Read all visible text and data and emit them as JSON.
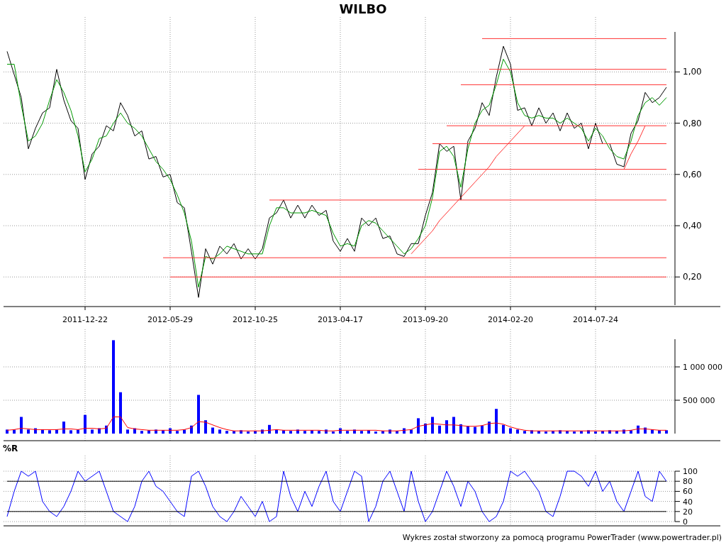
{
  "price_chart": {
    "chart_data": {
      "type": "line",
      "title": "WILBO",
      "categories": [
        null,
        null,
        null,
        null,
        null,
        null,
        null,
        null,
        null,
        null,
        null,
        "2011-12-22",
        null,
        null,
        null,
        null,
        null,
        null,
        null,
        null,
        null,
        null,
        null,
        "2012-05-29",
        null,
        null,
        null,
        null,
        null,
        null,
        null,
        null,
        null,
        null,
        null,
        "2012-10-25",
        null,
        null,
        null,
        null,
        null,
        null,
        null,
        null,
        null,
        null,
        null,
        "2013-04-17",
        null,
        null,
        null,
        null,
        null,
        null,
        null,
        null,
        null,
        null,
        null,
        "2013-09-20",
        null,
        null,
        null,
        null,
        null,
        null,
        null,
        null,
        null,
        null,
        null,
        "2014-02-20",
        null,
        null,
        null,
        null,
        null,
        null,
        null,
        null,
        null,
        null,
        null,
        "2014-07-24",
        null,
        null,
        null,
        null,
        null,
        null,
        null,
        null,
        null,
        null
      ],
      "series": [
        {
          "color": "#000000",
          "values": [
            1.08,
            0.99,
            0.9,
            0.7,
            0.78,
            0.84,
            0.86,
            1.01,
            0.89,
            0.81,
            0.78,
            0.58,
            0.68,
            0.71,
            0.79,
            0.77,
            0.88,
            0.83,
            0.75,
            0.77,
            0.66,
            0.67,
            0.59,
            0.6,
            0.49,
            0.47,
            0.3,
            0.12,
            0.31,
            0.25,
            0.32,
            0.29,
            0.33,
            0.27,
            0.31,
            0.27,
            0.31,
            0.43,
            0.45,
            0.5,
            0.43,
            0.48,
            0.43,
            0.48,
            0.44,
            0.46,
            0.34,
            0.3,
            0.35,
            0.3,
            0.43,
            0.4,
            0.43,
            0.35,
            0.36,
            0.29,
            0.28,
            0.33,
            0.33,
            0.44,
            0.53,
            0.72,
            0.69,
            0.71,
            0.5,
            0.73,
            0.78,
            0.88,
            0.83,
            0.98,
            1.1,
            1.03,
            0.85,
            0.86,
            0.79,
            0.86,
            0.8,
            0.84,
            0.77,
            0.84,
            0.78,
            0.8,
            0.7,
            0.8,
            0.72,
            0.72,
            0.64,
            0.63,
            0.76,
            0.81,
            0.92,
            0.88,
            0.9,
            0.94
          ]
        },
        {
          "color": "#009900",
          "values": [
            1.03,
            1.03,
            0.87,
            0.73,
            0.75,
            0.8,
            0.89,
            0.97,
            0.92,
            0.85,
            0.75,
            0.61,
            0.66,
            0.74,
            0.75,
            0.8,
            0.84,
            0.8,
            0.78,
            0.75,
            0.7,
            0.65,
            0.62,
            0.58,
            0.52,
            0.45,
            0.34,
            0.16,
            0.28,
            0.27,
            0.29,
            0.32,
            0.31,
            0.3,
            0.29,
            0.29,
            0.29,
            0.4,
            0.47,
            0.47,
            0.45,
            0.45,
            0.45,
            0.46,
            0.45,
            0.44,
            0.37,
            0.32,
            0.33,
            0.32,
            0.4,
            0.42,
            0.41,
            0.38,
            0.35,
            0.32,
            0.29,
            0.31,
            0.35,
            0.4,
            0.51,
            0.69,
            0.71,
            0.67,
            0.55,
            0.7,
            0.8,
            0.85,
            0.87,
            0.95,
            1.05,
            1.0,
            0.88,
            0.83,
            0.82,
            0.83,
            0.82,
            0.82,
            0.8,
            0.82,
            0.8,
            0.78,
            0.73,
            0.78,
            0.75,
            0.7,
            0.67,
            0.66,
            0.73,
            0.83,
            0.88,
            0.9,
            0.87,
            0.9
          ]
        },
        {
          "color": "#ff3333",
          "values": [
            null,
            null,
            null,
            null,
            null,
            null,
            null,
            null,
            null,
            null,
            null,
            null,
            null,
            null,
            null,
            null,
            null,
            null,
            null,
            null,
            null,
            null,
            0.275,
            0.275,
            0.275,
            0.275,
            0.275,
            0.275,
            0.275,
            0.275,
            0.275,
            0.275,
            0.275,
            0.275,
            0.275,
            0.275,
            0.275,
            0.275,
            0.275,
            0.275,
            0.275,
            0.275,
            0.275,
            0.275,
            0.275,
            0.275,
            0.275,
            0.275,
            0.275,
            0.275,
            0.275,
            0.275,
            0.275,
            0.275,
            0.275,
            0.275,
            0.275,
            0.275,
            0.275,
            0.275,
            0.275,
            0.275,
            0.275,
            0.275,
            0.275,
            0.275,
            0.275,
            0.275,
            0.275,
            0.275,
            0.275,
            0.275,
            0.275,
            0.275,
            0.275,
            0.275,
            0.275,
            0.275,
            0.275,
            0.275,
            0.275,
            0.275,
            0.275,
            0.275,
            0.275,
            0.275,
            0.275,
            0.275,
            0.275,
            0.275,
            0.275,
            0.275,
            0.275,
            0.275
          ]
        },
        {
          "color": "#ff3333",
          "values": [
            null,
            null,
            null,
            null,
            null,
            null,
            null,
            null,
            null,
            null,
            null,
            null,
            null,
            null,
            null,
            null,
            null,
            null,
            null,
            null,
            null,
            null,
            null,
            0.2,
            0.2,
            0.2,
            0.2,
            0.2,
            0.2,
            0.2,
            0.2,
            0.2,
            0.2,
            0.2,
            0.2,
            0.2,
            0.2,
            0.2,
            0.2,
            0.2,
            0.2,
            0.2,
            0.2,
            0.2,
            0.2,
            0.2,
            0.2,
            0.2,
            0.2,
            0.2,
            0.2,
            0.2,
            0.2,
            0.2,
            0.2,
            0.2,
            0.2,
            0.2,
            0.2,
            0.2,
            0.2,
            0.2,
            0.2,
            0.2,
            0.2,
            0.2,
            0.2,
            0.2,
            0.2,
            0.2,
            0.2,
            0.2,
            0.2,
            0.2,
            0.2,
            0.2,
            0.2,
            0.2,
            0.2,
            0.2,
            0.2,
            0.2,
            0.2,
            0.2,
            0.2,
            0.2,
            0.2,
            0.2,
            0.2,
            0.2,
            0.2,
            0.2,
            0.2,
            0.2
          ]
        },
        {
          "color": "#ff3333",
          "values": [
            null,
            null,
            null,
            null,
            null,
            null,
            null,
            null,
            null,
            null,
            null,
            null,
            null,
            null,
            null,
            null,
            null,
            null,
            null,
            null,
            null,
            null,
            null,
            null,
            null,
            null,
            null,
            null,
            null,
            null,
            null,
            null,
            null,
            null,
            null,
            null,
            null,
            0.5,
            0.5,
            0.5,
            0.5,
            0.5,
            0.5,
            0.5,
            0.5,
            0.5,
            0.5,
            0.5,
            0.5,
            0.5,
            0.5,
            0.5,
            0.5,
            0.5,
            0.5,
            0.5,
            0.5,
            0.5,
            0.5,
            0.5,
            0.5,
            0.5,
            0.5,
            0.5,
            0.5,
            0.5,
            0.5,
            0.5,
            0.5,
            0.5,
            0.5,
            0.5,
            0.5,
            0.5,
            0.5,
            0.5,
            0.5,
            0.5,
            0.5,
            0.5,
            0.5,
            0.5,
            0.5,
            0.5,
            0.5,
            0.5,
            0.5,
            0.5,
            0.5,
            0.5,
            0.5,
            0.5,
            0.5,
            0.5
          ]
        },
        {
          "color": "#ff3333",
          "values": [
            null,
            null,
            null,
            null,
            null,
            null,
            null,
            null,
            null,
            null,
            null,
            null,
            null,
            null,
            null,
            null,
            null,
            null,
            null,
            null,
            null,
            null,
            null,
            null,
            null,
            null,
            null,
            null,
            null,
            null,
            null,
            null,
            null,
            null,
            null,
            null,
            null,
            null,
            null,
            null,
            null,
            null,
            null,
            null,
            null,
            null,
            null,
            null,
            null,
            null,
            null,
            null,
            null,
            null,
            null,
            null,
            null,
            null,
            0.62,
            0.62,
            0.62,
            0.62,
            0.62,
            0.62,
            0.62,
            0.62,
            0.62,
            0.62,
            0.62,
            0.62,
            0.62,
            0.62,
            0.62,
            0.62,
            0.62,
            0.62,
            0.62,
            0.62,
            0.62,
            0.62,
            0.62,
            0.62,
            0.62,
            0.62,
            0.62,
            0.62,
            0.62,
            0.62,
            0.62,
            0.62,
            0.62,
            0.62,
            0.62,
            0.62
          ]
        },
        {
          "color": "#ff3333",
          "values": [
            null,
            null,
            null,
            null,
            null,
            null,
            null,
            null,
            null,
            null,
            null,
            null,
            null,
            null,
            null,
            null,
            null,
            null,
            null,
            null,
            null,
            null,
            null,
            null,
            null,
            null,
            null,
            null,
            null,
            null,
            null,
            null,
            null,
            null,
            null,
            null,
            null,
            null,
            null,
            null,
            null,
            null,
            null,
            null,
            null,
            null,
            null,
            null,
            null,
            null,
            null,
            null,
            null,
            null,
            null,
            null,
            null,
            null,
            null,
            null,
            0.72,
            0.72,
            0.72,
            0.72,
            0.72,
            0.72,
            0.72,
            0.72,
            0.72,
            0.72,
            0.72,
            0.72,
            0.72,
            0.72,
            0.72,
            0.72,
            0.72,
            0.72,
            0.72,
            0.72,
            0.72,
            0.72,
            0.72,
            0.72,
            0.72,
            0.72,
            0.72,
            0.72,
            0.72,
            0.72,
            0.72,
            0.72,
            0.72,
            0.72
          ]
        },
        {
          "color": "#ff3333",
          "values": [
            null,
            null,
            null,
            null,
            null,
            null,
            null,
            null,
            null,
            null,
            null,
            null,
            null,
            null,
            null,
            null,
            null,
            null,
            null,
            null,
            null,
            null,
            null,
            null,
            null,
            null,
            null,
            null,
            null,
            null,
            null,
            null,
            null,
            null,
            null,
            null,
            null,
            null,
            null,
            null,
            null,
            null,
            null,
            null,
            null,
            null,
            null,
            null,
            null,
            null,
            null,
            null,
            null,
            null,
            null,
            null,
            null,
            null,
            null,
            null,
            null,
            null,
            0.79,
            0.79,
            0.79,
            0.79,
            0.79,
            0.79,
            0.79,
            0.79,
            0.79,
            0.79,
            0.79,
            0.79,
            0.79,
            0.79,
            0.79,
            0.79,
            0.79,
            0.79,
            0.79,
            0.79,
            0.79,
            0.79,
            0.79,
            0.79,
            0.79,
            0.79,
            0.79,
            0.79,
            0.79,
            0.79,
            0.79,
            0.79
          ]
        },
        {
          "color": "#ff3333",
          "values": [
            null,
            null,
            null,
            null,
            null,
            null,
            null,
            null,
            null,
            null,
            null,
            null,
            null,
            null,
            null,
            null,
            null,
            null,
            null,
            null,
            null,
            null,
            null,
            null,
            null,
            null,
            null,
            null,
            null,
            null,
            null,
            null,
            null,
            null,
            null,
            null,
            null,
            null,
            null,
            null,
            null,
            null,
            null,
            null,
            null,
            null,
            null,
            null,
            null,
            null,
            null,
            null,
            null,
            null,
            null,
            null,
            null,
            null,
            null,
            null,
            null,
            null,
            null,
            null,
            0.95,
            0.95,
            0.95,
            0.95,
            0.95,
            0.95,
            0.95,
            0.95,
            0.95,
            0.95,
            0.95,
            0.95,
            0.95,
            0.95,
            0.95,
            0.95,
            0.95,
            0.95,
            0.95,
            0.95,
            0.95,
            0.95,
            0.95,
            0.95,
            0.95,
            0.95,
            0.95,
            0.95,
            0.95,
            0.95
          ]
        },
        {
          "color": "#ff3333",
          "values": [
            null,
            null,
            null,
            null,
            null,
            null,
            null,
            null,
            null,
            null,
            null,
            null,
            null,
            null,
            null,
            null,
            null,
            null,
            null,
            null,
            null,
            null,
            null,
            null,
            null,
            null,
            null,
            null,
            null,
            null,
            null,
            null,
            null,
            null,
            null,
            null,
            null,
            null,
            null,
            null,
            null,
            null,
            null,
            null,
            null,
            null,
            null,
            null,
            null,
            null,
            null,
            null,
            null,
            null,
            null,
            null,
            null,
            null,
            null,
            null,
            null,
            null,
            null,
            null,
            null,
            null,
            null,
            null,
            1.01,
            1.01,
            1.01,
            1.01,
            1.01,
            1.01,
            1.01,
            1.01,
            1.01,
            1.01,
            1.01,
            1.01,
            1.01,
            1.01,
            1.01,
            1.01,
            1.01,
            1.01,
            1.01,
            1.01,
            1.01,
            1.01,
            1.01,
            1.01,
            1.01,
            1.01
          ]
        },
        {
          "color": "#ff3333",
          "values": [
            null,
            null,
            null,
            null,
            null,
            null,
            null,
            null,
            null,
            null,
            null,
            null,
            null,
            null,
            null,
            null,
            null,
            null,
            null,
            null,
            null,
            null,
            null,
            null,
            null,
            null,
            null,
            null,
            null,
            null,
            null,
            null,
            null,
            null,
            null,
            null,
            null,
            null,
            null,
            null,
            null,
            null,
            null,
            null,
            null,
            null,
            null,
            null,
            null,
            null,
            null,
            null,
            null,
            null,
            null,
            null,
            null,
            null,
            null,
            null,
            null,
            null,
            null,
            null,
            null,
            null,
            null,
            1.13,
            1.13,
            1.13,
            1.13,
            1.13,
            1.13,
            1.13,
            1.13,
            1.13,
            1.13,
            1.13,
            1.13,
            1.13,
            1.13,
            1.13,
            1.13,
            1.13,
            1.13,
            1.13,
            1.13,
            1.13,
            1.13,
            1.13,
            1.13,
            1.13,
            1.13,
            1.13
          ]
        },
        {
          "color": "#ff3333",
          "values": [
            null,
            null,
            null,
            null,
            null,
            null,
            null,
            null,
            null,
            null,
            null,
            null,
            null,
            null,
            null,
            null,
            null,
            null,
            null,
            null,
            null,
            null,
            null,
            null,
            null,
            null,
            null,
            null,
            null,
            null,
            null,
            null,
            null,
            null,
            null,
            null,
            null,
            null,
            null,
            null,
            null,
            null,
            null,
            null,
            null,
            null,
            null,
            null,
            null,
            null,
            null,
            null,
            null,
            null,
            null,
            null,
            null,
            0.29,
            0.32,
            0.35,
            0.38,
            0.42,
            0.45,
            0.48,
            0.51,
            0.54,
            0.57,
            0.6,
            0.63,
            0.67,
            0.7,
            0.73,
            0.76,
            0.79,
            null,
            null,
            null,
            null,
            null,
            null,
            null,
            null,
            null,
            null,
            null,
            null,
            null,
            null,
            null,
            null,
            null,
            null,
            null,
            null
          ]
        },
        {
          "color": "#ff3333",
          "values": [
            null,
            null,
            null,
            null,
            null,
            null,
            null,
            null,
            null,
            null,
            null,
            null,
            null,
            null,
            null,
            null,
            null,
            null,
            null,
            null,
            null,
            null,
            null,
            null,
            null,
            null,
            null,
            null,
            null,
            null,
            null,
            null,
            null,
            null,
            null,
            null,
            null,
            null,
            null,
            null,
            null,
            null,
            null,
            null,
            null,
            null,
            null,
            null,
            null,
            null,
            null,
            null,
            null,
            null,
            null,
            null,
            null,
            null,
            null,
            null,
            null,
            null,
            null,
            null,
            null,
            null,
            null,
            null,
            null,
            null,
            null,
            null,
            null,
            null,
            null,
            null,
            null,
            null,
            null,
            null,
            null,
            null,
            null,
            null,
            null,
            null,
            null,
            0.62,
            0.68,
            0.73,
            0.79,
            null,
            null,
            null
          ]
        }
      ],
      "ylim": [
        0.09,
        1.156
      ],
      "grid": true,
      "yticks": [
        {
          "value": 0.2,
          "label": "0,20"
        },
        {
          "value": 0.4,
          "label": "0,40"
        },
        {
          "value": 0.6,
          "label": "0,60"
        },
        {
          "value": 0.8,
          "label": "0,80"
        },
        {
          "value": 1.0,
          "label": "1,00"
        }
      ]
    }
  },
  "volume_chart": {
    "chart_data": {
      "type": "bar",
      "series": [
        {
          "color": "#0000ff",
          "values": [
            60000,
            60000,
            250000,
            60000,
            80000,
            60000,
            50000,
            60000,
            180000,
            50000,
            60000,
            280000,
            60000,
            80000,
            120000,
            1400000,
            620000,
            60000,
            80000,
            40000,
            50000,
            60000,
            50000,
            80000,
            40000,
            60000,
            120000,
            580000,
            200000,
            90000,
            60000,
            40000,
            40000,
            50000,
            30000,
            40000,
            60000,
            130000,
            60000,
            50000,
            40000,
            60000,
            40000,
            50000,
            40000,
            60000,
            30000,
            80000,
            40000,
            60000,
            40000,
            50000,
            30000,
            40000,
            60000,
            40000,
            80000,
            60000,
            230000,
            150000,
            250000,
            120000,
            200000,
            250000,
            140000,
            110000,
            100000,
            120000,
            180000,
            370000,
            130000,
            80000,
            60000,
            40000,
            50000,
            40000,
            30000,
            40000,
            50000,
            40000,
            30000,
            40000,
            50000,
            30000,
            40000,
            50000,
            40000,
            60000,
            50000,
            120000,
            90000,
            60000,
            50000,
            50000
          ]
        },
        {
          "type": "line",
          "color": "#ff0000",
          "values": [
            50000,
            60000,
            80000,
            70000,
            60000,
            60000,
            60000,
            60000,
            70000,
            70000,
            60000,
            80000,
            80000,
            70000,
            80000,
            250000,
            250000,
            90000,
            70000,
            60000,
            50000,
            50000,
            50000,
            50000,
            50000,
            60000,
            90000,
            180000,
            170000,
            130000,
            90000,
            60000,
            40000,
            40000,
            40000,
            40000,
            40000,
            50000,
            60000,
            50000,
            50000,
            50000,
            50000,
            50000,
            50000,
            40000,
            40000,
            50000,
            50000,
            50000,
            50000,
            50000,
            50000,
            40000,
            40000,
            40000,
            50000,
            60000,
            110000,
            130000,
            150000,
            140000,
            130000,
            130000,
            120000,
            110000,
            110000,
            120000,
            150000,
            160000,
            140000,
            100000,
            70000,
            50000,
            40000,
            40000,
            40000,
            40000,
            40000,
            40000,
            40000,
            40000,
            40000,
            40000,
            40000,
            40000,
            40000,
            40000,
            50000,
            70000,
            70000,
            60000,
            50000,
            50000
          ]
        }
      ],
      "ylim": [
        0,
        1415000
      ],
      "grid": true,
      "yticks": [
        {
          "value": 500000,
          "label": "500 000"
        },
        {
          "value": 1000000,
          "label": "1 000 000"
        }
      ]
    }
  },
  "williams_chart": {
    "chart_data": {
      "type": "line",
      "title": "%R",
      "series": [
        {
          "color": "#0000ff",
          "values": [
            10,
            60,
            100,
            90,
            100,
            40,
            20,
            10,
            30,
            60,
            100,
            80,
            90,
            100,
            60,
            20,
            10,
            0,
            30,
            80,
            100,
            70,
            60,
            40,
            20,
            10,
            90,
            100,
            70,
            30,
            10,
            0,
            20,
            50,
            30,
            10,
            40,
            0,
            10,
            100,
            50,
            20,
            60,
            30,
            70,
            100,
            40,
            20,
            60,
            100,
            90,
            0,
            30,
            80,
            100,
            60,
            20,
            100,
            40,
            0,
            20,
            60,
            100,
            70,
            30,
            80,
            60,
            20,
            0,
            10,
            40,
            100,
            90,
            100,
            80,
            60,
            20,
            10,
            50,
            100,
            100,
            90,
            70,
            100,
            60,
            80,
            40,
            20,
            60,
            100,
            50,
            40,
            100,
            80
          ]
        },
        {
          "color": "#000000",
          "values": [
            80,
            80,
            80,
            80,
            80,
            80,
            80,
            80,
            80,
            80,
            80,
            80,
            80,
            80,
            80,
            80,
            80,
            80,
            80,
            80,
            80,
            80,
            80,
            80,
            80,
            80,
            80,
            80,
            80,
            80,
            80,
            80,
            80,
            80,
            80,
            80,
            80,
            80,
            80,
            80,
            80,
            80,
            80,
            80,
            80,
            80,
            80,
            80,
            80,
            80,
            80,
            80,
            80,
            80,
            80,
            80,
            80,
            80,
            80,
            80,
            80,
            80,
            80,
            80,
            80,
            80,
            80,
            80,
            80,
            80,
            80,
            80,
            80,
            80,
            80,
            80,
            80,
            80,
            80,
            80,
            80,
            80,
            80,
            80,
            80,
            80,
            80,
            80,
            80,
            80,
            80,
            80,
            80,
            80
          ]
        },
        {
          "color": "#000000",
          "values": [
            20,
            20,
            20,
            20,
            20,
            20,
            20,
            20,
            20,
            20,
            20,
            20,
            20,
            20,
            20,
            20,
            20,
            20,
            20,
            20,
            20,
            20,
            20,
            20,
            20,
            20,
            20,
            20,
            20,
            20,
            20,
            20,
            20,
            20,
            20,
            20,
            20,
            20,
            20,
            20,
            20,
            20,
            20,
            20,
            20,
            20,
            20,
            20,
            20,
            20,
            20,
            20,
            20,
            20,
            20,
            20,
            20,
            20,
            20,
            20,
            20,
            20,
            20,
            20,
            20,
            20,
            20,
            20,
            20,
            20,
            20,
            20,
            20,
            20,
            20,
            20,
            20,
            20,
            20,
            20,
            20,
            20,
            20,
            20,
            20,
            20,
            20,
            20,
            20,
            20,
            20,
            20,
            20,
            20
          ]
        }
      ],
      "ylim": [
        0,
        100
      ],
      "grid": true,
      "yticks": [
        {
          "value": 0,
          "label": "0"
        },
        {
          "value": 20,
          "label": "20"
        },
        {
          "value": 40,
          "label": "40"
        },
        {
          "value": 60,
          "label": "60"
        },
        {
          "value": 80,
          "label": "80"
        },
        {
          "value": 100,
          "label": "100"
        }
      ]
    }
  },
  "footer": "Wykres został stworzony za pomocą programu PowerTrader (www.powertrader.pl)"
}
